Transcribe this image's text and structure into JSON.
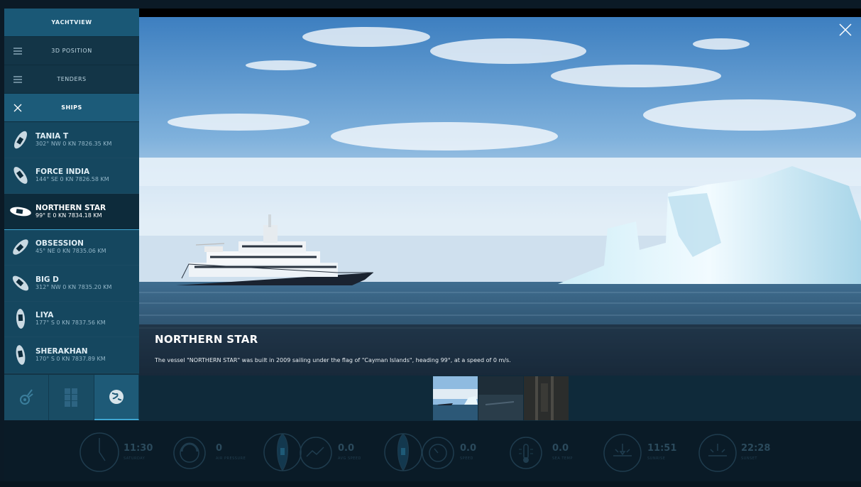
{
  "sidebar": {
    "header": "YACHTVIEW",
    "menu": [
      {
        "label": "3D POSITION",
        "icon": "menu-icon"
      },
      {
        "label": "TENDERS",
        "icon": "menu-icon"
      },
      {
        "label": "SHIPS",
        "icon": "close-icon"
      }
    ],
    "ships": [
      {
        "name": "TANIA T",
        "info": "302° NW 0 KN 7826.35 KM"
      },
      {
        "name": "FORCE INDIA",
        "info": "144° SE 0 KN 7826.58 KM"
      },
      {
        "name": "NORTHERN STAR",
        "info": "99° E 0 KN 7834.18 KM",
        "active": true
      },
      {
        "name": "OBSESSION",
        "info": "45° NE 0 KN 7835.06 KM"
      },
      {
        "name": "BIG D",
        "info": "312° NW 0 KN 7835.20 KM"
      },
      {
        "name": "LIYA",
        "info": "177° S 0 KN 7837.56 KM"
      },
      {
        "name": "SHERAKHAN",
        "info": "170° S 0 KN 7837.89 KM"
      }
    ],
    "modes": [
      "tools-icon",
      "grid-icon",
      "globe-icon"
    ]
  },
  "photo": {
    "title": "NORTHERN STAR",
    "description": "The vessel \"NORTHERN STAR\" was built in 2009 sailing under the flag of \"Cayman Islands\", heading 99°, at a speed of 0 m/s."
  },
  "dashboard": {
    "time": {
      "value": "11:30",
      "label": "SATURDAY"
    },
    "air_pressure": {
      "value": "0",
      "label": "AIR PRESSURE"
    },
    "avg_speed": {
      "value": "0.0",
      "label": "AVG SPEED"
    },
    "speed": {
      "value": "0.0",
      "label": "SPEED"
    },
    "sea_temp": {
      "value": "0.0",
      "label": "SEA TEMP"
    },
    "sunrise": {
      "value": "11:51",
      "label": "SUNRISE"
    },
    "sunset": {
      "value": "22:28",
      "label": "SUNSET"
    }
  },
  "colors": {
    "accent": "#3fa6d2",
    "sidebar": "#15475f",
    "active_row": "#0d2b3b"
  }
}
